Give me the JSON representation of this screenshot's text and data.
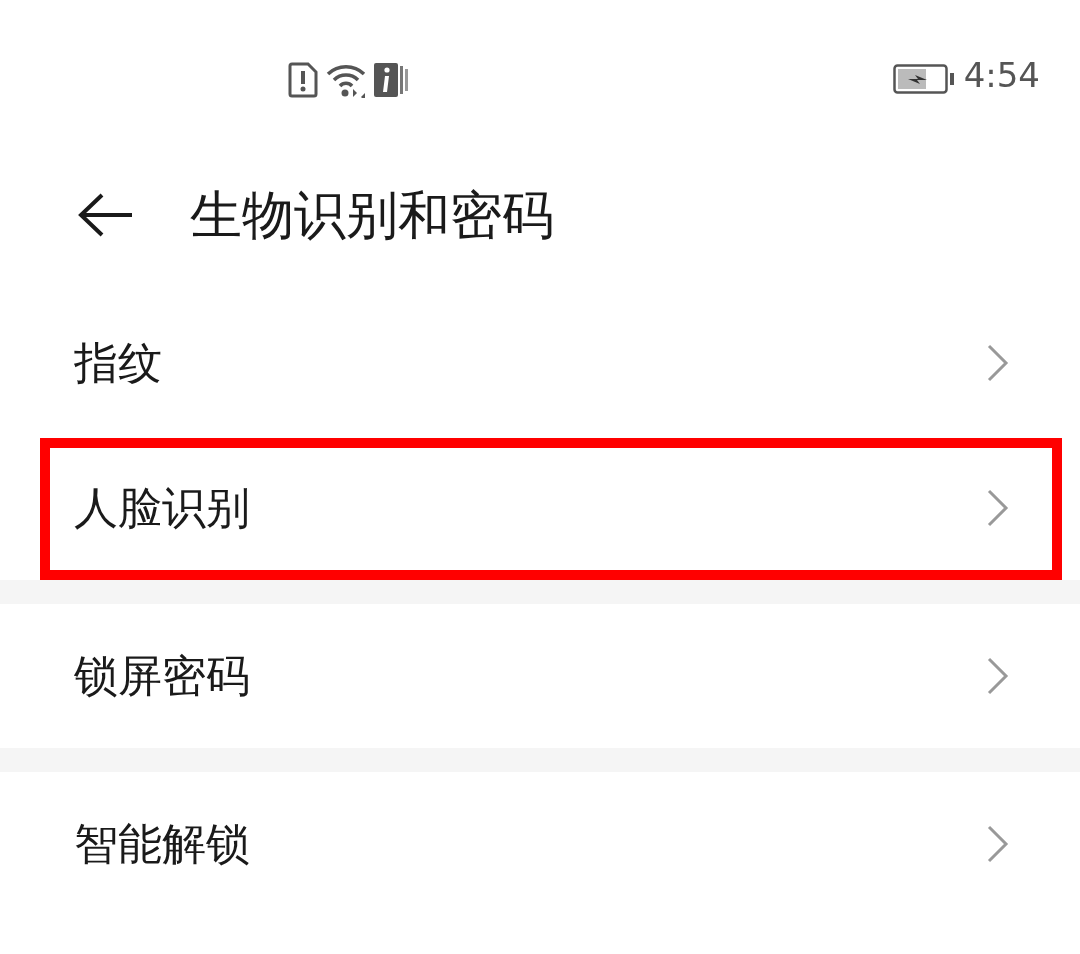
{
  "status_bar": {
    "time": "4:54"
  },
  "header": {
    "title": "生物识别和密码"
  },
  "groups": [
    {
      "items": [
        {
          "label": "指纹",
          "highlighted": false
        },
        {
          "label": "人脸识别",
          "highlighted": true
        }
      ]
    },
    {
      "items": [
        {
          "label": "锁屏密码",
          "highlighted": false
        }
      ]
    },
    {
      "items": [
        {
          "label": "智能解锁",
          "highlighted": false
        }
      ]
    }
  ]
}
